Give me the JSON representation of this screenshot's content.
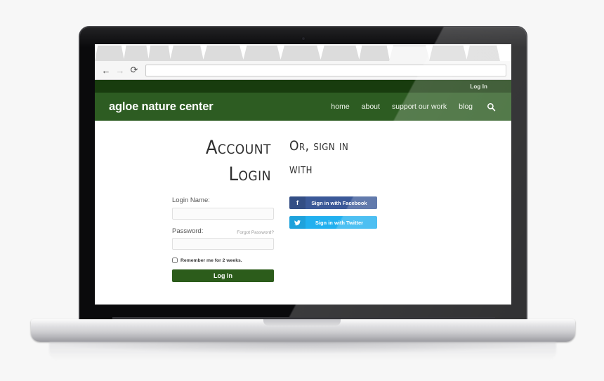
{
  "browser": {
    "back_icon": "back-arrow-icon",
    "forward_icon": "forward-arrow-icon",
    "reload_icon": "reload-icon",
    "url_value": "",
    "url_placeholder": "",
    "tab_count": 12
  },
  "site": {
    "utility_bar": {
      "login_label": "Log In"
    },
    "brand": "agloe nature center",
    "nav": [
      {
        "label": "home"
      },
      {
        "label": "about"
      },
      {
        "label": "support our work"
      },
      {
        "label": "blog"
      }
    ],
    "search_icon": "search-icon",
    "colors": {
      "utility_bar": "#183c0e",
      "header": "#2d5c22",
      "login_button": "#2c5c1b",
      "facebook": "#3b5998",
      "twitter": "#22b0ef"
    }
  },
  "login": {
    "heading_line1": "Account",
    "heading_line2": "Login",
    "name_label": "Login Name:",
    "name_value": "",
    "name_placeholder": "",
    "password_label": "Password:",
    "password_value": "",
    "password_placeholder": "",
    "forgot_label": "Forgot Password?",
    "remember_label": "Remember me for 2 weeks.",
    "remember_checked": false,
    "submit_label": "Log In"
  },
  "social": {
    "heading_line1": "Or, sign in",
    "heading_line2": "with",
    "facebook_label": "Sign in with Facebook",
    "facebook_icon": "facebook-icon",
    "facebook_glyph": "f",
    "twitter_label": "Sign in with Twitter",
    "twitter_icon": "twitter-icon"
  }
}
